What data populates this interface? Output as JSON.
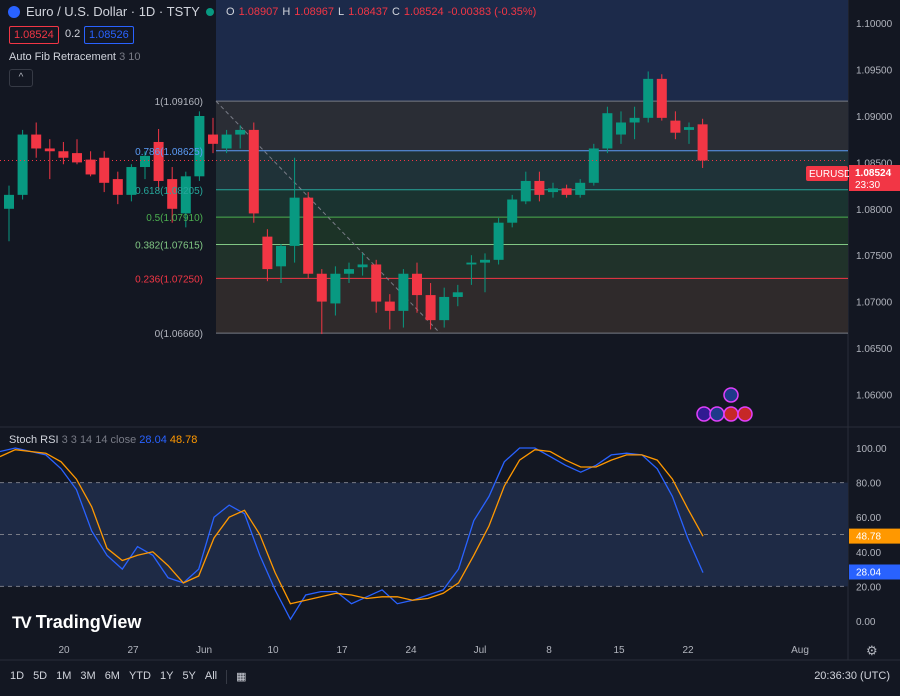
{
  "header": {
    "symbol_title": "Euro / U.S. Dollar · 1D · TSTY",
    "ohlc": [
      {
        "k": "O",
        "v": "1.08907"
      },
      {
        "k": "H",
        "v": "1.08967"
      },
      {
        "k": "L",
        "v": "1.08437"
      },
      {
        "k": "C",
        "v": "1.08524"
      },
      {
        "k": "",
        "v": "-0.00383 (-0.35%)"
      }
    ],
    "sell_price": "1.08524",
    "spread": "0.2",
    "buy_price": "1.08526"
  },
  "indicator": {
    "name": "Auto Fib Retracement",
    "params": "3 10",
    "collapse_glyph": "^"
  },
  "stoch": {
    "name": "Stoch RSI",
    "params": "3 3 14 14 close",
    "k_value": "28.04",
    "d_value": "48.78"
  },
  "branding": {
    "text": "TradingView",
    "mark": "TV"
  },
  "timeframes": [
    "1D",
    "5D",
    "1M",
    "3M",
    "6M",
    "YTD",
    "1Y",
    "5Y",
    "All"
  ],
  "clock": "20:36:30 (UTC)",
  "icons": {
    "settings": "gear-icon",
    "compare": "calendar-range-icon"
  },
  "colors": {
    "bg": "#131722",
    "up": "#089981",
    "down": "#f23645",
    "k_line": "#2962ff",
    "d_line": "#ff9800",
    "ob_band": "#1e2a45"
  },
  "chart_data": [
    {
      "type": "candlestick",
      "symbol": "EURUSD",
      "interval": "1D",
      "price_label": "1.08524",
      "countdown": "23:30",
      "x_labels": [
        "20",
        "27",
        "Jun",
        "10",
        "17",
        "24",
        "Jul",
        "8",
        "15",
        "22",
        "Aug"
      ],
      "y_labels": [
        "1.10000",
        "1.09500",
        "1.09000",
        "1.08500",
        "1.08000",
        "1.07500",
        "1.07000",
        "1.06500",
        "1.06000"
      ],
      "ylim": [
        1.0567,
        1.1025
      ],
      "candles": [
        {
          "x": 0,
          "o": 1.08,
          "h": 1.0825,
          "l": 1.0765,
          "c": 1.0815
        },
        {
          "x": 1,
          "o": 1.0815,
          "h": 1.0885,
          "l": 1.081,
          "c": 1.088
        },
        {
          "x": 2,
          "o": 1.088,
          "h": 1.0893,
          "l": 1.0855,
          "c": 1.0865
        },
        {
          "x": 3,
          "o": 1.0865,
          "h": 1.0875,
          "l": 1.0832,
          "c": 1.0862
        },
        {
          "x": 4,
          "o": 1.0862,
          "h": 1.0872,
          "l": 1.0848,
          "c": 1.0855
        },
        {
          "x": 5,
          "o": 1.086,
          "h": 1.0875,
          "l": 1.0848,
          "c": 1.085
        },
        {
          "x": 6,
          "o": 1.0853,
          "h": 1.0862,
          "l": 1.0835,
          "c": 1.0837
        },
        {
          "x": 7,
          "o": 1.0855,
          "h": 1.0862,
          "l": 1.0818,
          "c": 1.0828
        },
        {
          "x": 8,
          "o": 1.0832,
          "h": 1.084,
          "l": 1.0805,
          "c": 1.0815
        },
        {
          "x": 9,
          "o": 1.0815,
          "h": 1.0848,
          "l": 1.0808,
          "c": 1.0845
        },
        {
          "x": 10,
          "o": 1.0845,
          "h": 1.0862,
          "l": 1.0832,
          "c": 1.0857
        },
        {
          "x": 11,
          "o": 1.0872,
          "h": 1.0886,
          "l": 1.082,
          "c": 1.083
        },
        {
          "x": 12,
          "o": 1.0832,
          "h": 1.0845,
          "l": 1.0785,
          "c": 1.08
        },
        {
          "x": 13,
          "o": 1.0795,
          "h": 1.084,
          "l": 1.078,
          "c": 1.0835
        },
        {
          "x": 14,
          "o": 1.0835,
          "h": 1.0905,
          "l": 1.083,
          "c": 1.09
        },
        {
          "x": 15,
          "o": 1.088,
          "h": 1.0898,
          "l": 1.086,
          "c": 1.087
        },
        {
          "x": 16,
          "o": 1.0865,
          "h": 1.0885,
          "l": 1.086,
          "c": 1.088
        },
        {
          "x": 17,
          "o": 1.088,
          "h": 1.089,
          "l": 1.0865,
          "c": 1.0885
        },
        {
          "x": 18,
          "o": 1.0885,
          "h": 1.0893,
          "l": 1.0785,
          "c": 1.0795
        },
        {
          "x": 19,
          "o": 1.077,
          "h": 1.0778,
          "l": 1.0722,
          "c": 1.0735
        },
        {
          "x": 20,
          "o": 1.0738,
          "h": 1.0762,
          "l": 1.072,
          "c": 1.076
        },
        {
          "x": 21,
          "o": 1.076,
          "h": 1.0855,
          "l": 1.0742,
          "c": 1.0812
        },
        {
          "x": 22,
          "o": 1.0812,
          "h": 1.0818,
          "l": 1.0725,
          "c": 1.073
        },
        {
          "x": 23,
          "o": 1.073,
          "h": 1.0735,
          "l": 1.0665,
          "c": 1.07
        },
        {
          "x": 24,
          "o": 1.0698,
          "h": 1.0738,
          "l": 1.0685,
          "c": 1.073
        },
        {
          "x": 25,
          "o": 1.073,
          "h": 1.0742,
          "l": 1.072,
          "c": 1.0735
        },
        {
          "x": 26,
          "o": 1.0737,
          "h": 1.0752,
          "l": 1.0728,
          "c": 1.074
        },
        {
          "x": 27,
          "o": 1.074,
          "h": 1.0745,
          "l": 1.0688,
          "c": 1.07
        },
        {
          "x": 28,
          "o": 1.07,
          "h": 1.0708,
          "l": 1.067,
          "c": 1.069
        },
        {
          "x": 29,
          "o": 1.069,
          "h": 1.0735,
          "l": 1.0672,
          "c": 1.073
        },
        {
          "x": 30,
          "o": 1.073,
          "h": 1.0742,
          "l": 1.0688,
          "c": 1.0707
        },
        {
          "x": 31,
          "o": 1.0707,
          "h": 1.072,
          "l": 1.067,
          "c": 1.068
        },
        {
          "x": 32,
          "o": 1.068,
          "h": 1.0715,
          "l": 1.0672,
          "c": 1.0705
        },
        {
          "x": 33,
          "o": 1.0705,
          "h": 1.0718,
          "l": 1.0695,
          "c": 1.071
        },
        {
          "x": 34,
          "o": 1.074,
          "h": 1.075,
          "l": 1.0718,
          "c": 1.0742
        },
        {
          "x": 35,
          "o": 1.0742,
          "h": 1.0752,
          "l": 1.071,
          "c": 1.0745
        },
        {
          "x": 36,
          "o": 1.0745,
          "h": 1.079,
          "l": 1.074,
          "c": 1.0785
        },
        {
          "x": 37,
          "o": 1.0785,
          "h": 1.0815,
          "l": 1.078,
          "c": 1.081
        },
        {
          "x": 38,
          "o": 1.0808,
          "h": 1.084,
          "l": 1.0805,
          "c": 1.083
        },
        {
          "x": 39,
          "o": 1.083,
          "h": 1.084,
          "l": 1.0808,
          "c": 1.0815
        },
        {
          "x": 40,
          "o": 1.0818,
          "h": 1.0828,
          "l": 1.0812,
          "c": 1.0822
        },
        {
          "x": 41,
          "o": 1.0822,
          "h": 1.0826,
          "l": 1.0812,
          "c": 1.0815
        },
        {
          "x": 42,
          "o": 1.0815,
          "h": 1.0832,
          "l": 1.0812,
          "c": 1.0828
        },
        {
          "x": 43,
          "o": 1.0828,
          "h": 1.087,
          "l": 1.0825,
          "c": 1.0865
        },
        {
          "x": 44,
          "o": 1.0865,
          "h": 1.091,
          "l": 1.086,
          "c": 1.0903
        },
        {
          "x": 45,
          "o": 1.088,
          "h": 1.0905,
          "l": 1.087,
          "c": 1.0893
        },
        {
          "x": 46,
          "o": 1.0893,
          "h": 1.091,
          "l": 1.0875,
          "c": 1.0898
        },
        {
          "x": 47,
          "o": 1.0898,
          "h": 1.0948,
          "l": 1.0893,
          "c": 1.094
        },
        {
          "x": 48,
          "o": 1.094,
          "h": 1.0945,
          "l": 1.0895,
          "c": 1.0898
        },
        {
          "x": 49,
          "o": 1.0895,
          "h": 1.0905,
          "l": 1.0875,
          "c": 1.0882
        },
        {
          "x": 50,
          "o": 1.0885,
          "h": 1.0893,
          "l": 1.087,
          "c": 1.0888
        },
        {
          "x": 51,
          "o": 1.0891,
          "h": 1.0897,
          "l": 1.0844,
          "c": 1.0852
        }
      ],
      "fib_levels": [
        {
          "ratio": "1",
          "price": "1.09160"
        },
        {
          "ratio": "0.786",
          "price": "1.08625"
        },
        {
          "ratio": "0.618",
          "price": "1.08205"
        },
        {
          "ratio": "0.5",
          "price": "1.07910"
        },
        {
          "ratio": "0.382",
          "price": "1.07615"
        },
        {
          "ratio": "0.236",
          "price": "1.07250"
        },
        {
          "ratio": "0",
          "price": "1.06660"
        }
      ],
      "events": [
        "lightning-icon",
        "globe-icon",
        "globe-icon",
        "us-flag-icon",
        "us-flag-icon"
      ]
    },
    {
      "type": "line",
      "name": "Stoch RSI",
      "y_labels": [
        "100.00",
        "80.00",
        "60.00",
        "40.00",
        "20.00",
        "0.00"
      ],
      "ylim": [
        0,
        100
      ],
      "bands": [
        20,
        50,
        80
      ],
      "series": [
        {
          "name": "K",
          "values": [
            98,
            100,
            98,
            96,
            88,
            76,
            52,
            38,
            30,
            43,
            38,
            25,
            22,
            30,
            60,
            67,
            62,
            38,
            18,
            1,
            15,
            17,
            17,
            10,
            14,
            18,
            10,
            12,
            15,
            18,
            30,
            58,
            72,
            92,
            100,
            100,
            95,
            90,
            86,
            90,
            96,
            97,
            96,
            88,
            72,
            48,
            28
          ]
        },
        {
          "name": "D",
          "values": [
            95,
            99,
            98,
            97,
            92,
            82,
            66,
            42,
            35,
            38,
            40,
            32,
            22,
            26,
            48,
            60,
            64,
            50,
            28,
            10,
            12,
            14,
            16,
            15,
            13,
            14,
            14,
            12,
            13,
            16,
            22,
            38,
            55,
            78,
            93,
            99,
            98,
            93,
            89,
            89,
            93,
            96,
            96,
            93,
            82,
            65,
            49
          ]
        }
      ]
    }
  ]
}
